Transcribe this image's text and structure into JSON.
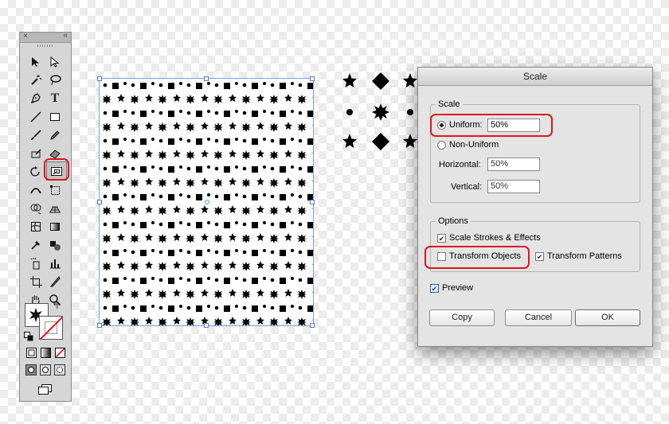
{
  "dialog": {
    "title": "Scale",
    "scale_group": {
      "legend": "Scale",
      "uniform_label": "Uniform:",
      "uniform_value": "50%",
      "uniform_selected": true,
      "non_uniform_label": "Non-Uniform",
      "horizontal_label": "Horizontal:",
      "horizontal_value": "50%",
      "vertical_label": "Vertical:",
      "vertical_value": "50%"
    },
    "options_group": {
      "legend": "Options",
      "scale_strokes_label": "Scale Strokes & Effects",
      "scale_strokes_checked": true,
      "transform_objects_label": "Transform Objects",
      "transform_objects_checked": false,
      "transform_patterns_label": "Transform Patterns",
      "transform_patterns_checked": true
    },
    "preview_label": "Preview",
    "preview_checked": true,
    "buttons": {
      "copy": "Copy",
      "cancel": "Cancel",
      "ok": "OK"
    }
  },
  "tools_panel": {
    "close_glyph": "×",
    "collapse_glyph": "«",
    "highlighted_tool": "scale-tool",
    "tools": [
      "selection-tool",
      "direct-selection-tool",
      "magic-wand-tool",
      "lasso-tool",
      "pen-tool",
      "type-tool",
      "line-segment-tool",
      "rectangle-tool",
      "paintbrush-tool",
      "pencil-tool",
      "blob-brush-tool",
      "eraser-tool",
      "rotate-tool",
      "scale-tool",
      "width-tool",
      "free-transform-tool",
      "shape-builder-tool",
      "perspective-grid-tool",
      "mesh-tool",
      "gradient-tool",
      "eyedropper-tool",
      "blend-tool",
      "symbol-sprayer-tool",
      "column-graph-tool",
      "artboard-tool",
      "slice-tool",
      "hand-tool",
      "zoom-tool"
    ]
  },
  "colors": {
    "highlight": "#e0151c",
    "selection_blue": "#4b7ad6",
    "dialog_bg": "#e4e4e4"
  }
}
